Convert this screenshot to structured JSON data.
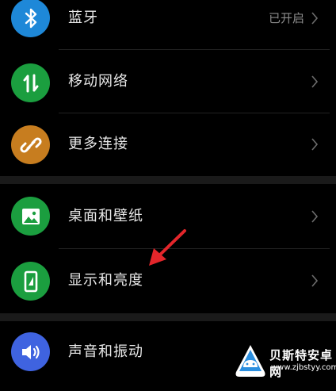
{
  "colors": {
    "background": "#000000",
    "bluetooth_icon": "#1e88d8",
    "mobile_network_icon": "#1b9e3f",
    "more_connections_icon": "#c77d1f",
    "wallpaper_icon": "#1b9e3f",
    "display_icon": "#1b9e3f",
    "sound_icon": "#3f63e0",
    "annotation_arrow": "#e3262b"
  },
  "settings": {
    "group1": [
      {
        "label": "蓝牙",
        "status": "已开启",
        "icon": "bluetooth-icon"
      },
      {
        "label": "移动网络",
        "icon": "mobile-data-icon"
      },
      {
        "label": "更多连接",
        "icon": "link-icon"
      }
    ],
    "group2": [
      {
        "label": "桌面和壁纸",
        "icon": "image-icon"
      },
      {
        "label": "显示和亮度",
        "icon": "phone-brightness-icon"
      }
    ],
    "group3": [
      {
        "label": "声音和振动",
        "icon": "speaker-icon"
      }
    ]
  },
  "watermark": {
    "title": "贝斯特安卓网",
    "url": "www.zjbstyy.com",
    "icon": "android-logo-icon"
  }
}
